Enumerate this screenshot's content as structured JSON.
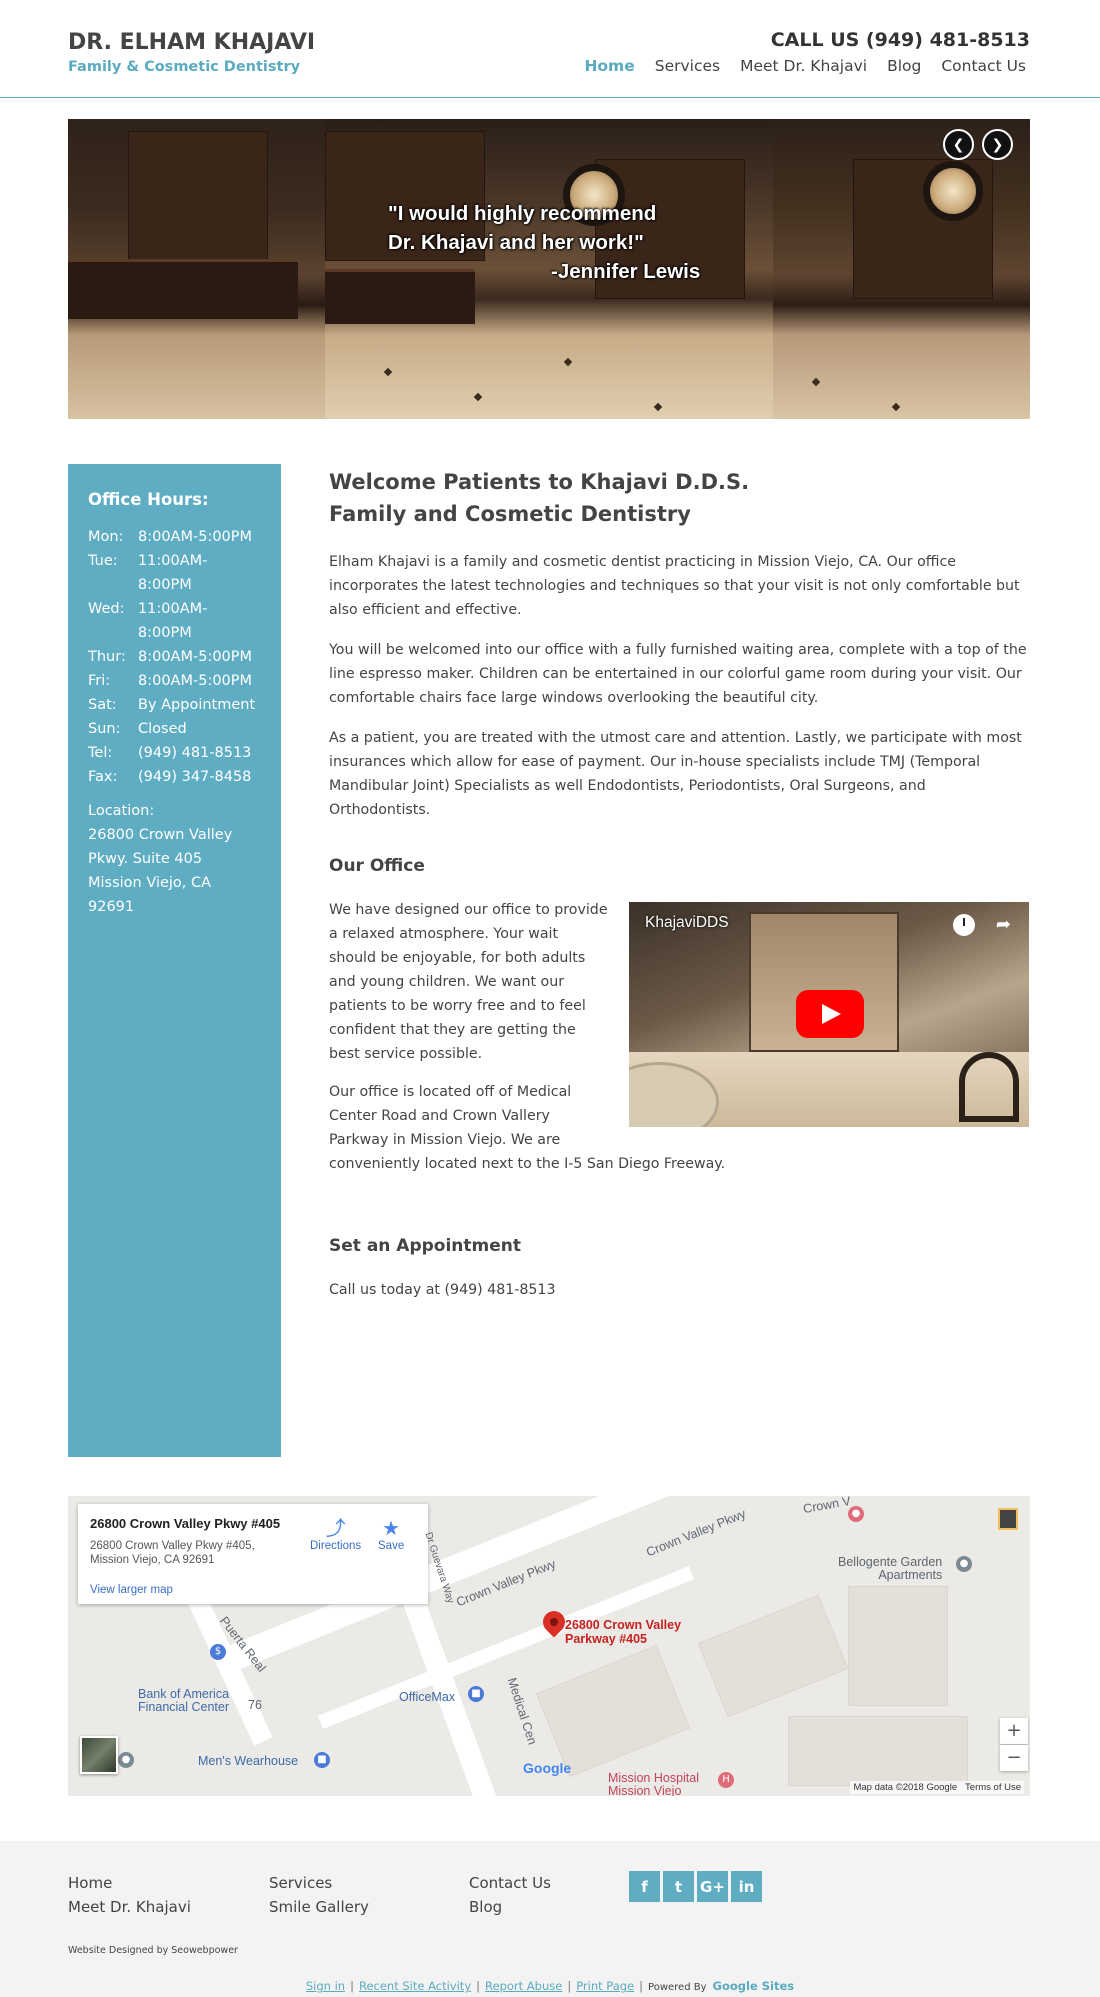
{
  "header": {
    "brand_name": "DR. ELHAM KHAJAVI",
    "brand_tagline": "Family & Cosmetic Dentistry",
    "call_us": "CALL US (949) 481-8513",
    "nav": [
      "Home",
      "Services",
      "Meet Dr. Khajavi",
      "Blog",
      "Contact Us"
    ],
    "active_nav": "Home"
  },
  "hero": {
    "quote_line1": "\"I would highly recommend",
    "quote_line2": "Dr. Khajavi and her work!\"",
    "quote_line3": "-Jennifer Lewis",
    "prev_icon": "chevron-left-icon",
    "next_icon": "chevron-right-icon"
  },
  "sidebar": {
    "title": "Office Hours:",
    "hours": [
      {
        "day": "Mon:",
        "time": "8:00AM-5:00PM"
      },
      {
        "day": "Tue:",
        "time": "11:00AM-8:00PM"
      },
      {
        "day": "Wed:",
        "time": "11:00AM-8:00PM"
      },
      {
        "day": "Thur:",
        "time": "8:00AM-5:00PM"
      },
      {
        "day": "Fri:",
        "time": "8:00AM-5:00PM"
      },
      {
        "day": "Sat:",
        "time": "By Appointment"
      },
      {
        "day": "Sun:",
        "time": "Closed"
      },
      {
        "day": "Tel:",
        "time": "(949) 481-8513"
      },
      {
        "day": "Fax:",
        "time": "(949) 347-8458"
      }
    ],
    "location_label": "Location:",
    "location_line1": "26800 Crown Valley",
    "location_line2": "Pkwy. Suite 405",
    "location_line3": "Mission Viejo, CA 92691"
  },
  "main": {
    "title_line1": "Welcome Patients to Khajavi D.D.S.",
    "title_line2": "Family and Cosmetic Dentistry",
    "intro_paragraphs": [
      "Elham Khajavi is a family and cosmetic dentist practicing in Mission Viejo, CA. Our office incorporates the latest technologies and techniques so that your visit is not only comfortable but also efficient and effective.",
      "You will be welcomed into our office with a fully furnished waiting area, complete with a top of the line espresso maker. Children can be entertained in our colorful game room during your visit. Our comfortable chairs face large windows overlooking the beautiful city.",
      "As a patient, you are treated with the utmost care and attention. Lastly, we participate with most insurances which allow for ease of payment. Our in-house specialists include TMJ (Temporal Mandibular Joint) Specialists as well Endodontists, Periodontists, Oral Surgeons, and Orthodontists."
    ],
    "office_heading": "Our Office",
    "office_p1": "We have designed our office to provide a relaxed atmosphere. Your wait should be enjoyable, for both adults and young children. We want our patients to be worry free and to feel confident that they are getting the best service possible.",
    "office_p2_part1": "Our office is located off of Medical Center Road and Crown Vallery Parkway in Mission Viejo. We are",
    "office_p2_part2": "conveniently  located next to the I-5 San Diego Freeway.",
    "appointment_heading": "Set an Appointment",
    "appointment_text": "Call us today at (949) 481-8513",
    "video_title": "KhajaviDDS"
  },
  "map": {
    "card_title": "26800 Crown Valley Pkwy #405",
    "card_addr_line1": "26800 Crown Valley Pkwy #405,",
    "card_addr_line2": "Mission Viejo, CA 92691",
    "directions": "Directions",
    "save": "Save",
    "view_larger": "View larger map",
    "pin_label_line1": "26800 Crown Valley",
    "pin_label_line2": "Parkway #405",
    "labels": {
      "crown_valley_1": "Crown Valley Pkwy",
      "crown_valley_2": "Crown Valley Pkwy",
      "crown_valley_3": "Crown V",
      "guevara": "Dr Guevara Way",
      "puerta_real": "Puerta Real",
      "boa_line1": "Bank of America",
      "boa_line2": "Financial Center",
      "route_76": "76",
      "officemax": "OfficeMax",
      "mens_wearhouse": "Men's Wearhouse",
      "medical_center": "Medical Cen",
      "bellogente_line1": "Bellogente Garden",
      "bellogente_line2": "Apartments",
      "mission_hospital_line1": "Mission Hospital",
      "mission_hospital_line2": "Mission Viejo"
    },
    "zoom_in": "+",
    "zoom_out": "−",
    "google": "Google",
    "attribution": "Map data ©2018 Google",
    "terms": "Terms of Use"
  },
  "footer": {
    "col1": [
      "Home",
      "Meet Dr. Khajavi"
    ],
    "col2": [
      "Services",
      "Smile Gallery"
    ],
    "col3": [
      "Contact Us",
      "Blog"
    ],
    "social": [
      {
        "icon": "facebook-icon",
        "glyph": "f"
      },
      {
        "icon": "twitter-icon",
        "glyph": "t"
      },
      {
        "icon": "google-plus-icon",
        "glyph": "G+"
      },
      {
        "icon": "linkedin-icon",
        "glyph": "in"
      }
    ],
    "designed_by": "Website Designed by Seowebpower",
    "sites_links": [
      "Sign in",
      "Recent Site Activity",
      "Report Abuse",
      "Print Page"
    ],
    "powered_by": "Powered By",
    "google_sites": "Google Sites"
  },
  "colors": {
    "accent": "#5aabbf",
    "sidebar_bg": "#5fadc2",
    "text": "#444444",
    "footer_bg": "#f3f3f3"
  }
}
